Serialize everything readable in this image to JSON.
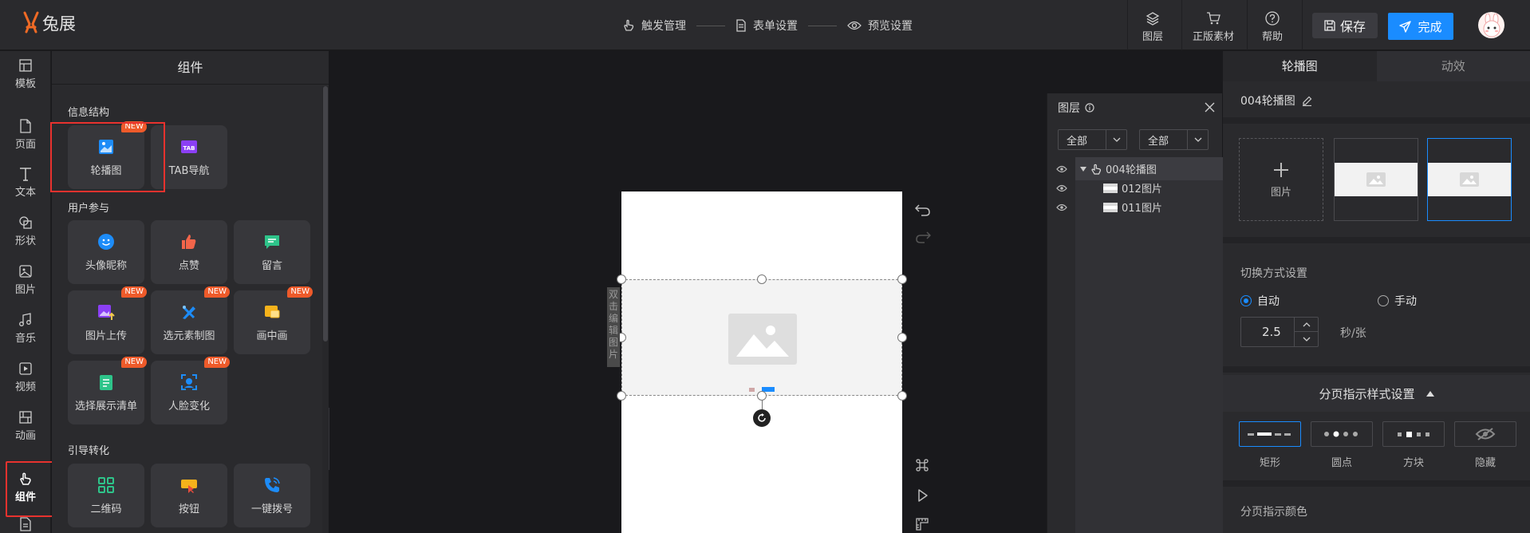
{
  "app": {
    "brand": "兔展"
  },
  "steps": [
    {
      "label": "触发管理",
      "icon": "hand-pointer-icon"
    },
    {
      "label": "表单设置",
      "icon": "document-icon"
    },
    {
      "label": "预览设置",
      "icon": "eye-icon"
    }
  ],
  "toolbar": {
    "layers": "图层",
    "assets": "正版素材",
    "help": "帮助",
    "save": "保存",
    "done": "完成"
  },
  "rail": [
    {
      "label": "模板",
      "icon": "template-icon"
    },
    {
      "label": "页面",
      "icon": "page-icon"
    },
    {
      "label": "文本",
      "icon": "text-icon"
    },
    {
      "label": "形状",
      "icon": "shape-icon"
    },
    {
      "label": "图片",
      "icon": "image-icon"
    },
    {
      "label": "音乐",
      "icon": "music-icon"
    },
    {
      "label": "视频",
      "icon": "video-icon"
    },
    {
      "label": "动画",
      "icon": "animation-icon"
    },
    {
      "label": "组件",
      "icon": "component-icon",
      "active": true
    }
  ],
  "components": {
    "title": "组件",
    "sections": [
      {
        "title": "信息结构",
        "items": [
          {
            "label": "轮播图",
            "badge": "NEW",
            "icon": "carousel-icon"
          },
          {
            "label": "TAB导航",
            "badge": "",
            "icon": "tab-nav-icon"
          }
        ]
      },
      {
        "title": "用户参与",
        "items": [
          {
            "label": "头像昵称",
            "badge": "",
            "icon": "avatar-nickname-icon"
          },
          {
            "label": "点赞",
            "badge": "",
            "icon": "thumbs-up-icon"
          },
          {
            "label": "留言",
            "badge": "",
            "icon": "message-icon"
          },
          {
            "label": "图片上传",
            "badge": "NEW",
            "icon": "image-upload-icon"
          },
          {
            "label": "选元素制图",
            "badge": "NEW",
            "icon": "element-draw-icon"
          },
          {
            "label": "画中画",
            "badge": "NEW",
            "icon": "picture-in-picture-icon"
          },
          {
            "label": "选择展示清单",
            "badge": "NEW",
            "icon": "checklist-icon"
          },
          {
            "label": "人脸变化",
            "badge": "NEW",
            "icon": "face-scan-icon"
          }
        ]
      },
      {
        "title": "引导转化",
        "items": [
          {
            "label": "二维码",
            "badge": "",
            "icon": "qrcode-icon"
          },
          {
            "label": "按钮",
            "badge": "",
            "icon": "button-icon"
          },
          {
            "label": "一键拨号",
            "badge": "",
            "icon": "phone-icon"
          }
        ]
      }
    ]
  },
  "canvas": {
    "tip_chars": [
      "双",
      "击",
      "编",
      "辑",
      "图",
      "片"
    ]
  },
  "layers": {
    "title": "图层",
    "filter1": "全部",
    "filter2": "全部",
    "items": [
      {
        "name": "004轮播图",
        "selected": true
      },
      {
        "name": "012图片",
        "selected": false
      },
      {
        "name": "011图片",
        "selected": false
      }
    ]
  },
  "props": {
    "tabs": [
      "轮播图",
      "动效"
    ],
    "component_name": "004轮播图",
    "add_image": "图片",
    "switch_title": "切换方式设置",
    "mode_auto": "自动",
    "mode_manual": "手动",
    "mode_selected": "自动",
    "interval": "2.5",
    "interval_unit": "秒/张",
    "pager_title": "分页指示样式设置",
    "pager_styles": [
      {
        "label": "矩形",
        "selected": true
      },
      {
        "label": "圆点",
        "selected": false
      },
      {
        "label": "方块",
        "selected": false
      },
      {
        "label": "隐藏",
        "selected": false
      }
    ],
    "pager_color": "分页指示颜色"
  },
  "colors": {
    "accent": "#1a8cff",
    "highlight": "#e8322e",
    "badge": "#ee5a2a",
    "logo": "#ef6a25"
  }
}
